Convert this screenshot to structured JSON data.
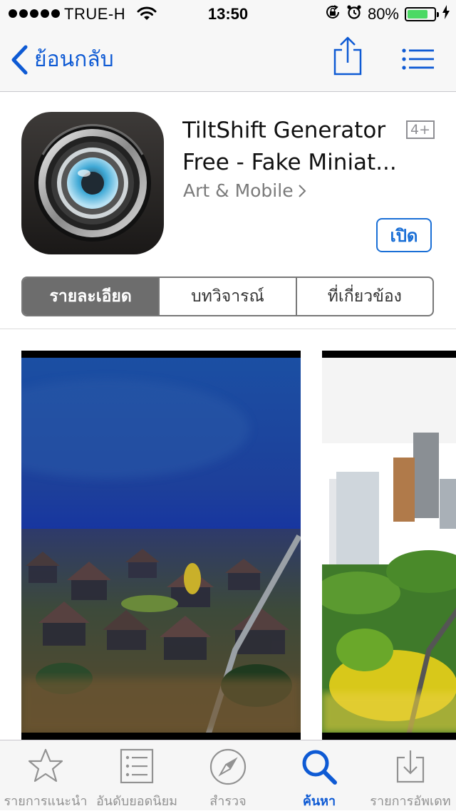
{
  "status": {
    "carrier": "TRUE-H",
    "time": "13:50",
    "battery": "80%",
    "battery_level": 0.8
  },
  "nav": {
    "back_label": "ย้อนกลับ"
  },
  "app": {
    "title_line1": "TiltShift Generator",
    "title_line2": "Free - Fake Miniat...",
    "age_rating": "4+",
    "developer": "Art & Mobile",
    "open_label": "เปิด"
  },
  "segments": [
    {
      "label": "รายละเอียด",
      "active": true
    },
    {
      "label": "บทวิจารณ์",
      "active": false
    },
    {
      "label": "ที่เกี่ยวข้อง",
      "active": false
    }
  ],
  "tabs": [
    {
      "label": "รายการแนะนำ",
      "icon": "star-icon"
    },
    {
      "label": "อันดับยอดนิยม",
      "icon": "top-charts-icon"
    },
    {
      "label": "สำรวจ",
      "icon": "compass-icon"
    },
    {
      "label": "ค้นหา",
      "icon": "search-icon",
      "active": true
    },
    {
      "label": "รายการอัพเดท",
      "icon": "updates-icon"
    }
  ],
  "colors": {
    "accent": "#0e5ad4",
    "battery": "#4cd964",
    "segment_active": "#6d6d6d"
  }
}
